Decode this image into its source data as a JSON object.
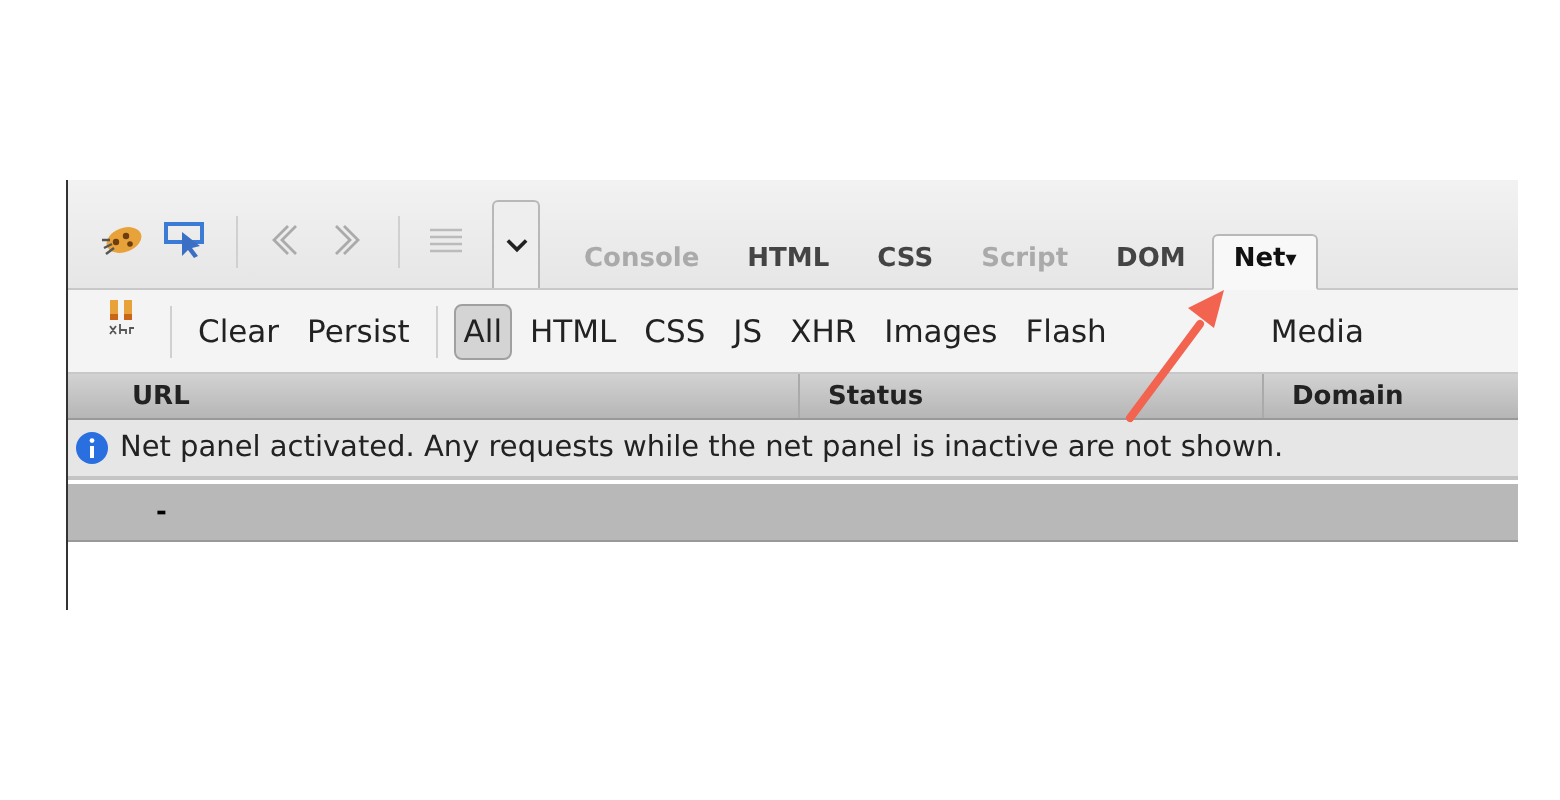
{
  "panel_tabs": [
    {
      "label": "Console",
      "selected": false,
      "disabled": true
    },
    {
      "label": "HTML",
      "selected": false,
      "disabled": false
    },
    {
      "label": "CSS",
      "selected": false,
      "disabled": false
    },
    {
      "label": "Script",
      "selected": false,
      "disabled": true
    },
    {
      "label": "DOM",
      "selected": false,
      "disabled": false
    },
    {
      "label": "Net",
      "selected": true,
      "disabled": false,
      "dropdown": "▾"
    }
  ],
  "net_toolbar": {
    "actions": [
      "Clear",
      "Persist"
    ],
    "filters": [
      {
        "label": "All",
        "selected": true
      },
      {
        "label": "HTML",
        "selected": false
      },
      {
        "label": "CSS",
        "selected": false
      },
      {
        "label": "JS",
        "selected": false
      },
      {
        "label": "XHR",
        "selected": false
      },
      {
        "label": "Images",
        "selected": false
      },
      {
        "label": "Flash",
        "selected": false
      },
      {
        "label": "Media",
        "selected": false
      }
    ]
  },
  "table": {
    "columns": [
      "URL",
      "Status",
      "Domain"
    ],
    "info_message": "Net panel activated. Any requests while the net panel is inactive are not shown.",
    "summary_row": "-"
  }
}
